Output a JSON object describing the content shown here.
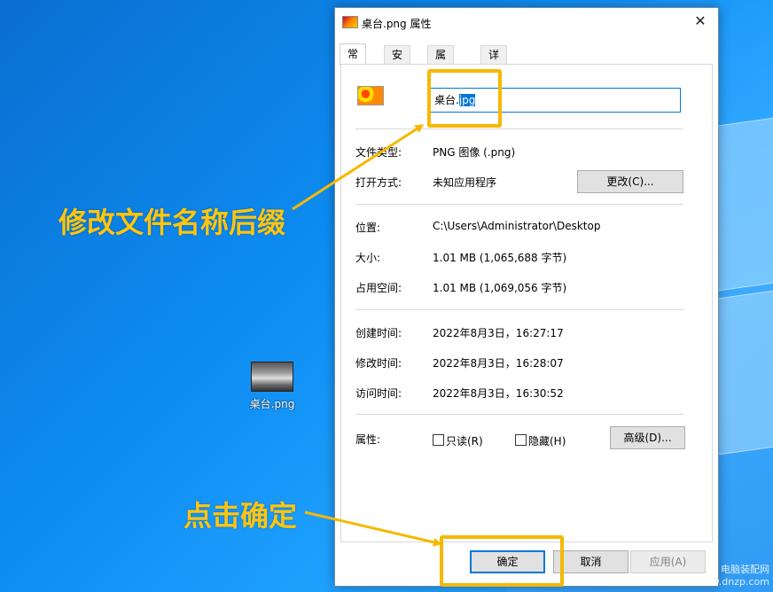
{
  "desktop": {
    "icon_label": "桌台.png"
  },
  "dialog": {
    "title": "桌台.png 属性",
    "close_glyph": "✕",
    "tabs": [
      {
        "label": "常规"
      },
      {
        "label": "安全"
      },
      {
        "label": "属性修改"
      },
      {
        "label": "详细信息"
      }
    ],
    "filename": {
      "base": "桌台.",
      "selected_ext": "jpg"
    },
    "rows": {
      "file_type": {
        "label": "文件类型:",
        "value": "PNG 图像 (.png)"
      },
      "open_with": {
        "label": "打开方式:",
        "value": "未知应用程序",
        "button": "更改(C)..."
      },
      "location": {
        "label": "位置:",
        "value": "C:\\Users\\Administrator\\Desktop"
      },
      "size": {
        "label": "大小:",
        "value": "1.01 MB (1,065,688 字节)"
      },
      "disk_size": {
        "label": "占用空间:",
        "value": "1.01 MB (1,069,056 字节)"
      },
      "created": {
        "label": "创建时间:",
        "value": "2022年8月3日，16:27:17"
      },
      "modified": {
        "label": "修改时间:",
        "value": "2022年8月3日，16:28:07"
      },
      "accessed": {
        "label": "访问时间:",
        "value": "2022年8月3日，16:30:52"
      }
    },
    "attributes": {
      "label": "属性:",
      "readonly": "只读(R)",
      "hidden": "隐藏(H)",
      "advanced_button": "高级(D)..."
    },
    "buttons": {
      "ok": "确定",
      "cancel": "取消",
      "apply": "应用(A)"
    }
  },
  "annotations": {
    "rename_hint": "修改文件名称后缀",
    "ok_hint": "点击确定"
  },
  "watermark": {
    "line1": "电脑装配网",
    "line2": "www.dnzp.com"
  },
  "colors": {
    "highlight": "#f6b800",
    "annotation_text": "#ffc510",
    "selection": "#0078d7"
  }
}
